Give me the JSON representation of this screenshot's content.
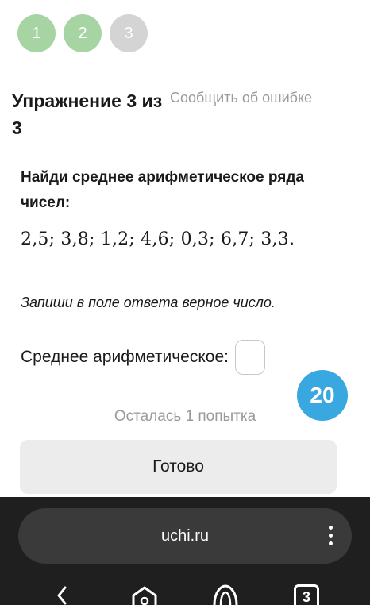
{
  "progress": {
    "steps": [
      {
        "label": "1",
        "state": "done"
      },
      {
        "label": "2",
        "state": "done"
      },
      {
        "label": "3",
        "state": "current"
      }
    ]
  },
  "exercise": {
    "title": "Упражнение 3 из 3",
    "report_link": "Сообщить об ошибке",
    "question": "Найди среднее арифметическое ряда чисел:",
    "numbers": "2,5; 3,8; 1,2; 4,6; 0,3; 6,7; 3,3.",
    "instruction": "Запиши в поле ответа верное число.",
    "answer_label": "Среднее арифметическое:",
    "answer_value": ""
  },
  "timer": {
    "value": "20"
  },
  "attempts_text": "Осталась 1 попытка",
  "submit_label": "Готово",
  "browser": {
    "url": "uchi.ru",
    "tab_count": "3"
  },
  "colors": {
    "step_done": "#a6d5a3",
    "step_todo": "#d4d4d4",
    "timer": "#3aa8e0",
    "browser_bg": "#1f1f1f"
  }
}
